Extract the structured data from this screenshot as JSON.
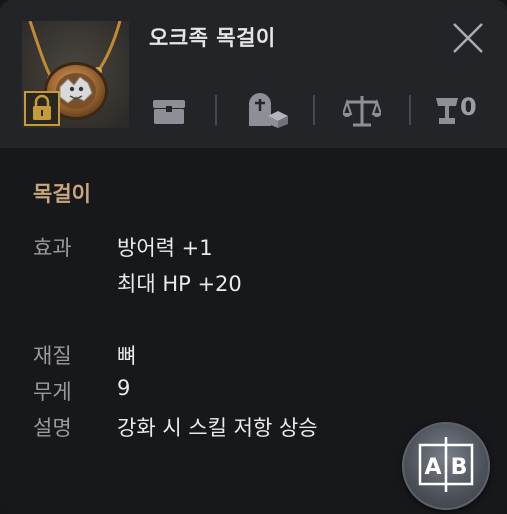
{
  "item": {
    "name": "오크족 목걸이",
    "category": "목걸이",
    "locked": true
  },
  "header_stats": {
    "icons": [
      "storage-chest-icon",
      "tombstone-box-icon",
      "scales-icon",
      "trophy-icon"
    ],
    "trophy_count": "0"
  },
  "details": {
    "effect_label": "효과",
    "effect_lines": [
      "방어력 +1",
      "최대 HP +20"
    ],
    "material_label": "재질",
    "material_value": "뼈",
    "weight_label": "무게",
    "weight_value": "9",
    "description_label": "설명",
    "description_value": "강화 시 스킬 저항 상승"
  },
  "compare_button": {
    "label": "AB"
  },
  "colors": {
    "header_bg": "#222428",
    "body_bg": "#17181b",
    "category_text": "#c8a67f",
    "lock_border": "#c59a38"
  }
}
